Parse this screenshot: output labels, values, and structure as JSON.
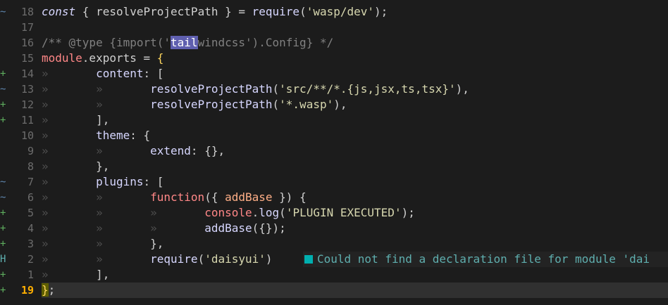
{
  "editor": {
    "lines": [
      {
        "sign": "~",
        "num": "18",
        "seg": [
          [
            "const",
            "kw-it"
          ],
          [
            " { resolveProjectPath } = ",
            "pl"
          ],
          [
            "require",
            "fn"
          ],
          [
            "(",
            "pl"
          ],
          [
            "'wasp/dev'",
            "str"
          ],
          [
            ");",
            "pl"
          ]
        ]
      },
      {
        "sign": "",
        "num": "17",
        "seg": []
      },
      {
        "sign": "",
        "num": "16",
        "seg": [
          [
            "/** @type {import('",
            "cmt"
          ],
          [
            "tail",
            "hl-word"
          ],
          [
            "windcss').Config} */",
            "cmt"
          ]
        ]
      },
      {
        "sign": "",
        "num": "15",
        "seg": [
          [
            "module",
            "mod"
          ],
          [
            ".exports = ",
            "pl"
          ],
          [
            "{",
            "paren-y"
          ]
        ]
      },
      {
        "sign": "+",
        "num": "14",
        "seg": [
          [
            "»       ",
            "guide"
          ],
          [
            "content",
            "prop"
          ],
          [
            ": [",
            "pl"
          ]
        ]
      },
      {
        "sign": "~",
        "num": "13",
        "seg": [
          [
            "»       »       ",
            "guide"
          ],
          [
            "resolveProjectPath",
            "fn"
          ],
          [
            "(",
            "pl"
          ],
          [
            "'src/**/*.{js,jsx,ts,tsx}'",
            "str"
          ],
          [
            "),",
            "pl"
          ]
        ]
      },
      {
        "sign": "+",
        "num": "12",
        "seg": [
          [
            "»       »       ",
            "guide"
          ],
          [
            "resolveProjectPath",
            "fn"
          ],
          [
            "(",
            "pl"
          ],
          [
            "'*.wasp'",
            "str"
          ],
          [
            "),",
            "pl"
          ]
        ]
      },
      {
        "sign": "+",
        "num": "11",
        "seg": [
          [
            "»       ",
            "guide"
          ],
          [
            "],",
            "pl"
          ]
        ]
      },
      {
        "sign": "",
        "num": "10",
        "seg": [
          [
            "»       ",
            "guide"
          ],
          [
            "theme",
            "prop"
          ],
          [
            ": {",
            "pl"
          ]
        ]
      },
      {
        "sign": "",
        "num": "9",
        "seg": [
          [
            "»       »       ",
            "guide"
          ],
          [
            "extend",
            "prop"
          ],
          [
            ": {},",
            "pl"
          ]
        ]
      },
      {
        "sign": "",
        "num": "8",
        "seg": [
          [
            "»       ",
            "guide"
          ],
          [
            "},",
            "pl"
          ]
        ]
      },
      {
        "sign": "~",
        "num": "7",
        "seg": [
          [
            "»       ",
            "guide"
          ],
          [
            "plugins",
            "prop"
          ],
          [
            ": [",
            "pl"
          ]
        ]
      },
      {
        "sign": "~",
        "num": "6",
        "seg": [
          [
            "»       »       ",
            "guide"
          ],
          [
            "function",
            "mod"
          ],
          [
            "({ ",
            "pl"
          ],
          [
            "addBase",
            "arg"
          ],
          [
            " }) {",
            "pl"
          ]
        ]
      },
      {
        "sign": "+",
        "num": "5",
        "seg": [
          [
            "»       »       »       ",
            "guide"
          ],
          [
            "console",
            "mod"
          ],
          [
            ".",
            "pl"
          ],
          [
            "log",
            "fn"
          ],
          [
            "(",
            "pl"
          ],
          [
            "'PLUGIN EXECUTED'",
            "str"
          ],
          [
            ");",
            "pl"
          ]
        ]
      },
      {
        "sign": "+",
        "num": "4",
        "seg": [
          [
            "»       »       »       ",
            "guide"
          ],
          [
            "addBase",
            "fn"
          ],
          [
            "({});",
            "pl"
          ]
        ]
      },
      {
        "sign": "+",
        "num": "3",
        "seg": [
          [
            "»       »       ",
            "guide"
          ],
          [
            "},",
            "pl"
          ]
        ]
      },
      {
        "sign": "H",
        "num": "2",
        "seg": [
          [
            "»       »       ",
            "guide"
          ],
          [
            "require",
            "fn"
          ],
          [
            "(",
            "pl"
          ],
          [
            "'daisyui'",
            "str"
          ],
          [
            ")",
            "pl"
          ]
        ],
        "diagnostic": "Could not find a declaration file for module 'dai"
      },
      {
        "sign": "+",
        "num": "1",
        "seg": [
          [
            "»       ",
            "guide"
          ],
          [
            "],",
            "pl"
          ]
        ]
      },
      {
        "sign": "+",
        "num": "19",
        "seg": [
          [
            "}",
            "match"
          ],
          [
            ";",
            "pl"
          ]
        ],
        "current": true
      }
    ]
  }
}
